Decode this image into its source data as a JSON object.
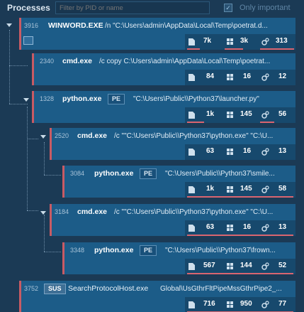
{
  "header": {
    "title": "Processes",
    "filter_placeholder": "Filter by PID or name",
    "only_important_label": "Only important",
    "only_important_checked": true
  },
  "processes": [
    {
      "pid": "3916",
      "name": "WINWORD.EXE",
      "tag": "",
      "cmd": "/n \"C:\\Users\\admin\\AppData\\Local\\Temp\\poetrat.d...",
      "files": "7k",
      "modules": "3k",
      "threads": "313"
    },
    {
      "pid": "2340",
      "name": "cmd.exe",
      "tag": "",
      "cmd": "/c copy C:\\Users\\admin\\AppData\\Local\\Temp\\poetrat...",
      "files": "84",
      "modules": "16",
      "threads": "12"
    },
    {
      "pid": "1328",
      "name": "python.exe",
      "tag": "PE",
      "cmd": "\"C:\\Users\\Public\\\\Python37\\launcher.py\"",
      "files": "1k",
      "modules": "145",
      "threads": "56"
    },
    {
      "pid": "2520",
      "name": "cmd.exe",
      "tag": "",
      "cmd": "/c \"\"C:\\Users\\Public\\\\Python37\\python.exe\" \"C:\\U...",
      "files": "63",
      "modules": "16",
      "threads": "13"
    },
    {
      "pid": "3084",
      "name": "python.exe",
      "tag": "PE",
      "cmd": "\"C:\\Users\\Public\\\\Python37\\smile...",
      "files": "1k",
      "modules": "145",
      "threads": "58"
    },
    {
      "pid": "3184",
      "name": "cmd.exe",
      "tag": "",
      "cmd": "/c \"\"C:\\Users\\Public\\\\Python37\\python.exe\" \"C:\\U...",
      "files": "63",
      "modules": "16",
      "threads": "13"
    },
    {
      "pid": "3348",
      "name": "python.exe",
      "tag": "PE",
      "cmd": "\"C:\\Users\\Public\\\\Python37\\frown...",
      "files": "567",
      "modules": "144",
      "threads": "52"
    },
    {
      "pid": "3752",
      "name": "SearchProtocolHost.exe",
      "tag": "SUS",
      "cmd": "Global\\UsGthrFltPipeMssGthrPipe2_...",
      "files": "716",
      "modules": "950",
      "threads": "77"
    }
  ],
  "colors": {
    "background": "#1b3a55",
    "card": "#1c5c88",
    "stats": "#17496d",
    "accent_red": "#c85b64"
  },
  "icons": {
    "files": "file-icon",
    "modules": "modules-icon",
    "threads": "gears-icon",
    "expand": "caret-down-icon",
    "app": "window-icon"
  }
}
